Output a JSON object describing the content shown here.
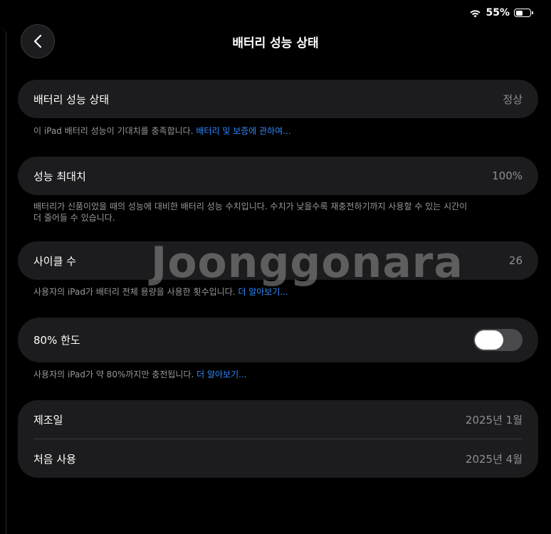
{
  "status_bar": {
    "battery_percent": "55%",
    "battery_level": 0.55
  },
  "nav": {
    "title": "배터리 성능 상태"
  },
  "health": {
    "label": "배터리 성능 상태",
    "value": "정상",
    "footer_text": "이 iPad 배터리 성능이 기대치를 충족합니다. ",
    "footer_link": "배터리 및 보증에 관하여..."
  },
  "max_capacity": {
    "label": "성능 최대치",
    "value": "100%",
    "footer_line1": "배터리가 신품이었을 때의 성능에 대비한 배터리 성능 수치입니다. 수치가 낮을수록 재충전하기까지 사용할 수 있는 시간이",
    "footer_line2": "더 줄어들 수 있습니다."
  },
  "cycle_count": {
    "label": "사이클 수",
    "value": "26",
    "footer_text": "사용자의 iPad가 배터리 전체 용량을 사용한 횟수입니다. ",
    "footer_link": "더 알아보기..."
  },
  "limit_80": {
    "label": "80% 한도",
    "toggle_on": false,
    "footer_text": "사용자의 iPad가 약 80%까지만 충전됩니다. ",
    "footer_link": "더 알아보기..."
  },
  "dates": {
    "manufacture_label": "제조일",
    "manufacture_value": "2025년 1월",
    "first_use_label": "처음 사용",
    "first_use_value": "2025년 4월"
  },
  "watermark": "Joonggonara",
  "icons": {
    "back": "chevron-left-icon",
    "wifi": "wifi-icon",
    "battery": "battery-icon"
  }
}
